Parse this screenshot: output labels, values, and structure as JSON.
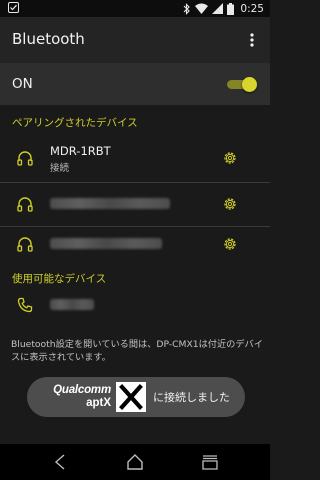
{
  "status_bar": {
    "time": "0:25",
    "icons": [
      "notification-check-icon",
      "bluetooth-icon",
      "wifi-icon",
      "signal-icon",
      "battery-icon"
    ]
  },
  "app_bar": {
    "title": "Bluetooth",
    "menu_icon": "overflow-menu-icon"
  },
  "toggle_row": {
    "label": "ON",
    "state": true,
    "accent": "#d8d62c"
  },
  "paired_section": {
    "header": "ペアリングされたデバイス",
    "devices": [
      {
        "name": "MDR-1RBT",
        "status": "接続",
        "icon": "headphones-icon"
      },
      {
        "name": "",
        "status": "",
        "icon": "headphones-icon",
        "obscured": true
      },
      {
        "name": "",
        "status": "",
        "icon": "headphones-icon",
        "obscured": true
      }
    ]
  },
  "available_section": {
    "header": "使用可能なデバイス",
    "devices": [
      {
        "name": "",
        "icon": "phone-icon",
        "obscured": true
      }
    ]
  },
  "footer_note": "Bluetooth設定を開いている間は、DP-CMX1は付近のデバイスに表示されています。",
  "toast": {
    "logo_line1": "Qualcomm",
    "logo_line2": "aptX",
    "message": "に接続しました"
  },
  "nav_bar": {
    "icons": [
      "back-icon",
      "home-icon",
      "recents-icon"
    ]
  }
}
